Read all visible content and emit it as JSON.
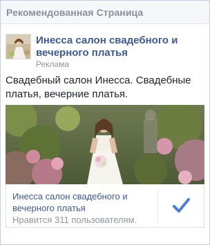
{
  "header": {
    "title": "Рекомендованная Страница"
  },
  "ad": {
    "page_name": "Инесса салон свадебного и вечерного платья",
    "sponsored_label": "Реклама",
    "body_text": "Свадебный салон Инесса. Свадебные платья, вечерние платья.",
    "like_box": {
      "page_name": "Инесса салон свадебного и вечерного платья",
      "likes_text": "Нравится 311 пользователям."
    }
  },
  "colors": {
    "link": "#3b5998",
    "muted": "#90949c",
    "check": "#4a7ddb"
  },
  "icons": {
    "like_status": "checkmark-icon"
  }
}
